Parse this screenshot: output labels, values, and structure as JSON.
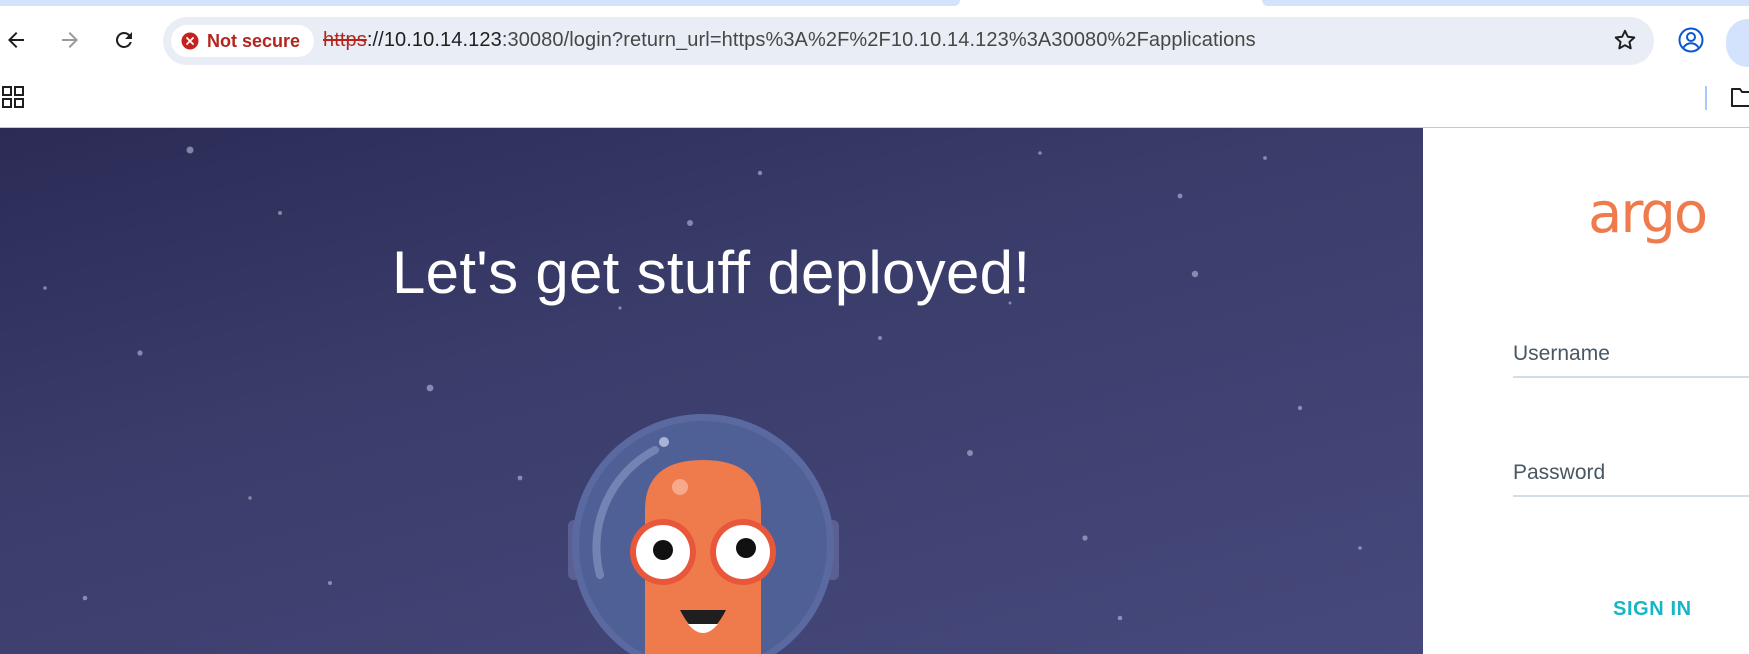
{
  "browser": {
    "security_chip": "Not secure",
    "url_scheme": "https",
    "url_host": "://10.10.14.123",
    "url_rest": ":30080/login?return_url=https%3A%2F%2F10.10.14.123%3A30080%2Fapplications",
    "icons": [
      "back-arrow-icon",
      "forward-arrow-icon",
      "reload-icon",
      "error-circle-icon",
      "star-icon",
      "profile-icon",
      "apps-grid-icon",
      "folder-icon"
    ]
  },
  "page": {
    "hero_title": "Let's get stuff deployed!",
    "logo_text": "argo",
    "username_label": "Username",
    "password_label": "Password",
    "signin_label": "SIGN IN"
  },
  "colors": {
    "accent_orange": "#ef7b4d",
    "signin_teal": "#18b4c7",
    "hero_bg": "#3a3c6a",
    "not_secure_red": "#b3261e"
  }
}
